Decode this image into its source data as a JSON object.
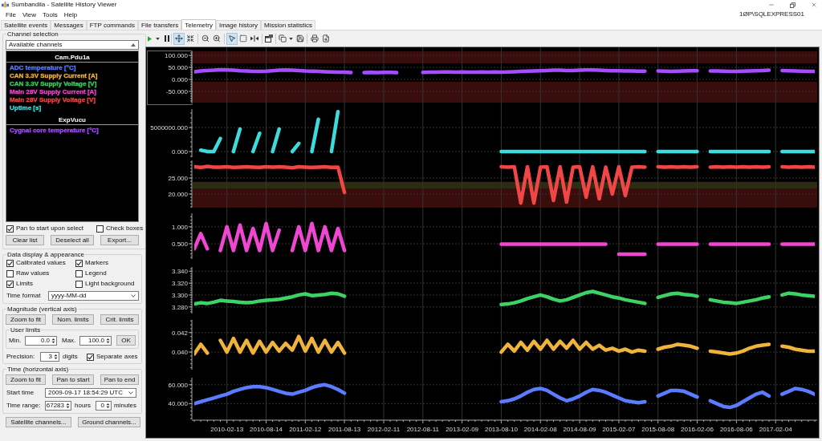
{
  "window": {
    "title": "Sumbandila - Satellite History Viewer"
  },
  "menu": [
    "File",
    "View",
    "Tools",
    "Help"
  ],
  "server": "1ØP\\SQLEXPRESS01",
  "tabs": [
    {
      "label": "Satellite events",
      "selected": false
    },
    {
      "label": "Messages",
      "selected": false
    },
    {
      "label": "FTP commands",
      "selected": false
    },
    {
      "label": "File transfers",
      "selected": false
    },
    {
      "label": "Telemetry",
      "selected": true
    },
    {
      "label": "Image history",
      "selected": false
    },
    {
      "label": "Mission statistics",
      "selected": false
    }
  ],
  "channel_selection": {
    "title": "Channel selection",
    "source": "Available channels",
    "groups": [
      {
        "name": "Cam.Pdu1a",
        "channels": [
          {
            "label": "ADC temperature [°C]",
            "color": "#5b7cff"
          },
          {
            "label": "CAN 3.3V Supply Current [A]",
            "color": "#f0b43c"
          },
          {
            "label": "CAN 3.3V Supply Voltage [V]",
            "color": "#3cd264"
          },
          {
            "label": "Main 28V Supply Current [A]",
            "color": "#f046d2"
          },
          {
            "label": "Main 28V Supply Voltage [V]",
            "color": "#f04646"
          },
          {
            "label": "Uptime [s]",
            "color": "#3cdcdc"
          }
        ]
      },
      {
        "name": "ExpVucu",
        "channels": [
          {
            "label": "Cygnal core temperature [°C]",
            "color": "#a64dff"
          }
        ]
      }
    ],
    "options": [
      {
        "label": "Pan to start upon select",
        "checked": true
      },
      {
        "label": "Check boxes",
        "checked": false
      }
    ],
    "buttons": [
      "Clear list",
      "Deselect all",
      "Export..."
    ]
  },
  "data_display": {
    "title": "Data display & appearance",
    "options": [
      {
        "label": "Calibrated values",
        "checked": true
      },
      {
        "label": "Markers",
        "checked": true
      },
      {
        "label": "Raw values",
        "checked": false
      },
      {
        "label": "Legend",
        "checked": false
      },
      {
        "label": "Limits",
        "checked": true
      },
      {
        "label": "Light background",
        "checked": false
      }
    ],
    "time_format": {
      "label": "Time format",
      "value": "yyyy-MM-dd"
    }
  },
  "magnitude": {
    "title": "Magnitude (vertical axis)",
    "buttons": [
      "Zoom to fit",
      "Nom. limits",
      "Crit. limits"
    ],
    "user_limits": {
      "title": "User limits",
      "min_label": "Min.",
      "min": "0.0",
      "max_label": "Max.",
      "max": "100.0",
      "ok": "OK"
    },
    "precision": {
      "label": "Precision:",
      "value": "3",
      "unit": "digits"
    },
    "separate_axes": {
      "label": "Separate axes",
      "checked": true
    }
  },
  "time_axis": {
    "title": "Time (horizontal axis)",
    "buttons": [
      "Zoom to fit",
      "Pan to start",
      "Pan to end"
    ],
    "start_time": {
      "label": "Start time",
      "value": "2009-09-17 18:54:29 UTC"
    },
    "time_range": {
      "label": "Time range:",
      "hours": "67283",
      "hours_unit": "hours",
      "minutes": "0",
      "minutes_unit": "minutes"
    }
  },
  "footer_buttons": [
    "Satellite channels...",
    "Ground channels..."
  ],
  "toolbar": {
    "navigation_modes": [
      {
        "selected": true
      },
      {
        "selected": false
      }
    ],
    "cursor_modes": [
      {
        "selected": true
      },
      {
        "selected": false
      },
      {
        "selected": false
      }
    ]
  },
  "plots": [
    {
      "selected": true,
      "chart_data": {
        "type": "line",
        "grid": true,
        "ylim": [
          -97,
          117
        ],
        "yticks": [
          {
            "value": 100,
            "label": "100.000"
          },
          {
            "value": 50,
            "label": "50.000"
          },
          {
            "value": 0,
            "label": "0.000"
          },
          {
            "value": -50,
            "label": "-50.000"
          }
        ],
        "bands": [
          {
            "axis": "y",
            "from": 67,
            "to": 117,
            "color": "#3a0d0d"
          },
          {
            "axis": "y",
            "from": -97,
            "to": -10,
            "color": "#3a0d0d"
          }
        ],
        "categories": [
          null,
          null,
          null,
          null,
          null,
          null,
          null,
          null,
          null,
          null,
          null,
          null,
          null,
          null,
          null,
          null,
          null,
          null,
          null,
          null,
          null,
          null,
          null,
          null,
          null,
          null,
          null,
          null,
          null,
          null,
          null,
          null,
          null,
          null,
          null,
          null,
          null,
          null,
          null,
          null,
          null,
          null,
          null,
          null,
          null,
          null,
          null,
          null,
          null,
          null,
          null,
          null,
          null,
          null,
          null,
          null,
          null,
          null,
          null,
          null,
          null,
          null,
          null,
          null,
          null,
          null,
          null,
          null,
          null,
          null,
          null,
          null,
          null,
          null,
          null,
          null,
          null,
          null,
          null,
          null,
          null,
          null,
          null,
          null,
          null,
          null,
          null,
          null,
          null,
          null,
          null,
          null,
          null,
          null,
          null,
          null
        ],
        "series": [
          {
            "color": "#a64dff",
            "values": [
              32,
              35,
              37,
              38,
              40,
              39,
              38,
              36,
              35,
              33,
              33,
              34,
              36,
              38,
              39,
              38,
              37,
              35,
              34,
              33,
              32,
              31,
              30,
              30,
              28,
              null,
              28,
              29,
              28,
              29,
              29,
              28,
              null,
              null,
              null,
              29,
              30,
              30,
              31,
              31,
              30,
              31,
              30,
              30,
              31,
              30,
              31,
              30,
              31,
              32,
              33,
              34,
              35,
              36,
              37,
              38,
              38,
              37,
              37,
              38,
              39,
              39,
              38,
              37,
              36,
              36,
              35,
              35,
              34,
              34,
              null,
              35,
              34,
              33,
              34,
              35,
              36,
              36,
              null,
              35,
              35,
              34,
              33,
              33,
              34,
              35,
              36,
              37,
              38,
              null,
              37,
              36,
              35,
              34,
              33,
              33
            ]
          }
        ]
      }
    },
    {
      "selected": false,
      "chart_data": {
        "type": "line",
        "grid": true,
        "ylim": [
          -1170000,
          8830000
        ],
        "yticks": [
          {
            "value": 5000000,
            "label": "5000000.000"
          },
          {
            "value": 0,
            "label": "0.000"
          }
        ],
        "categories": [
          null,
          null,
          null,
          null,
          null,
          null,
          null,
          null,
          null,
          null,
          null,
          null,
          null,
          null,
          null,
          null,
          null,
          null,
          null,
          null,
          null,
          null,
          null,
          null,
          null,
          null,
          null,
          null,
          null,
          null,
          null,
          null,
          null,
          null,
          null,
          null,
          null,
          null,
          null,
          null,
          null,
          null,
          null,
          null,
          null,
          null,
          null,
          null,
          null,
          null,
          null,
          null,
          null,
          null,
          null,
          null,
          null,
          null,
          null,
          null,
          null,
          null,
          null,
          null,
          null,
          null,
          null,
          null,
          null,
          null,
          null,
          null,
          null,
          null,
          null,
          null,
          null,
          null,
          null,
          null,
          null,
          null,
          null,
          null,
          null,
          null,
          null,
          null,
          null,
          null,
          null,
          null,
          null,
          null,
          null,
          null
        ],
        "series": [
          {
            "color": "#3cdcdc",
            "values": [
              null,
              300000,
              0,
              0,
              2700000,
              null,
              0,
              4700000,
              null,
              0,
              3800000,
              null,
              0,
              4700000,
              null,
              0,
              1700000,
              null,
              0,
              6700000,
              null,
              0,
              8300000,
              null,
              null,
              null,
              null,
              null,
              null,
              null,
              null,
              null,
              null,
              null,
              null,
              null,
              null,
              null,
              null,
              null,
              null,
              null,
              null,
              null,
              null,
              null,
              null,
              0,
              0,
              0,
              0,
              0,
              0,
              0,
              0,
              0,
              0,
              0,
              0,
              0,
              0,
              0,
              0,
              0,
              0,
              0,
              0,
              0,
              0,
              0,
              null,
              0,
              0,
              0,
              0,
              0,
              0,
              0,
              null,
              0,
              0,
              0,
              0,
              0,
              0,
              0,
              0,
              0,
              0,
              null,
              0,
              0,
              0,
              0,
              0,
              0
            ]
          }
        ]
      }
    },
    {
      "selected": false,
      "chart_data": {
        "type": "line",
        "grid": true,
        "ylim": [
          15.75,
          30.5
        ],
        "yticks": [
          {
            "value": 25,
            "label": "25.000"
          },
          {
            "value": 20,
            "label": "20.000"
          }
        ],
        "bands": [
          {
            "axis": "y",
            "from": 21.6,
            "to": 23.8,
            "color": "#2c2c12"
          },
          {
            "axis": "y",
            "from": 15.75,
            "to": 21.6,
            "color": "#3a0d0d"
          }
        ],
        "categories": [
          null,
          null,
          null,
          null,
          null,
          null,
          null,
          null,
          null,
          null,
          null,
          null,
          null,
          null,
          null,
          null,
          null,
          null,
          null,
          null,
          null,
          null,
          null,
          null,
          null,
          null,
          null,
          null,
          null,
          null,
          null,
          null,
          null,
          null,
          null,
          null,
          null,
          null,
          null,
          null,
          null,
          null,
          null,
          null,
          null,
          null,
          null,
          null,
          null,
          null,
          null,
          null,
          null,
          null,
          null,
          null,
          null,
          null,
          null,
          null,
          null,
          null,
          null,
          null,
          null,
          null,
          null,
          null,
          null,
          null,
          null,
          null,
          null,
          null,
          null,
          null,
          null,
          null,
          null,
          null,
          null,
          null,
          null,
          null,
          null,
          null,
          null,
          null,
          null,
          null,
          null,
          null,
          null,
          null,
          null,
          null
        ],
        "series": [
          {
            "color": "#f04646",
            "values": [
              28.5,
              28.3,
              28.6,
              28.4,
              28.4,
              28.5,
              28.3,
              28.4,
              28.5,
              28.4,
              28.3,
              28.5,
              28.4,
              28.5,
              28.4,
              28.2,
              28.5,
              28.4,
              28.3,
              28.4,
              28.5,
              28.3,
              28.4,
              20.5,
              null,
              null,
              null,
              null,
              null,
              null,
              null,
              null,
              null,
              null,
              null,
              null,
              null,
              null,
              null,
              null,
              null,
              null,
              null,
              null,
              null,
              null,
              null,
              28.5,
              28.4,
              28.5,
              17.2,
              28.5,
              17.2,
              28.4,
              28.5,
              18,
              28.5,
              17.5,
              28.4,
              28.5,
              19,
              28.5,
              18.5,
              28.4,
              20,
              28.5,
              19.5,
              28.4,
              28.5,
              28.4,
              null,
              28.5,
              28.4,
              28.5,
              28.4,
              28.5,
              28.4,
              28.5,
              null,
              28.4,
              28.5,
              28.4,
              28.5,
              28.4,
              28.5,
              28.4,
              28.5,
              28.4,
              28.5,
              null,
              28.5,
              28.4,
              28.5,
              28.4,
              28.5,
              28.4
            ]
          }
        ]
      }
    },
    {
      "selected": false,
      "chart_data": {
        "type": "line",
        "grid": true,
        "ylim": [
          0.05,
          1.4
        ],
        "yticks": [
          {
            "value": 1,
            "label": "1.000"
          },
          {
            "value": 0.5,
            "label": "0.500"
          }
        ],
        "categories": [
          null,
          null,
          null,
          null,
          null,
          null,
          null,
          null,
          null,
          null,
          null,
          null,
          null,
          null,
          null,
          null,
          null,
          null,
          null,
          null,
          null,
          null,
          null,
          null,
          null,
          null,
          null,
          null,
          null,
          null,
          null,
          null,
          null,
          null,
          null,
          null,
          null,
          null,
          null,
          null,
          null,
          null,
          null,
          null,
          null,
          null,
          null,
          null,
          null,
          null,
          null,
          null,
          null,
          null,
          null,
          null,
          null,
          null,
          null,
          null,
          null,
          null,
          null,
          null,
          null,
          null,
          null,
          null,
          null,
          null,
          null,
          null,
          null,
          null,
          null,
          null,
          null,
          null,
          null,
          null,
          null,
          null,
          null,
          null,
          null,
          null,
          null,
          null,
          null,
          null,
          null,
          null,
          null,
          null,
          null,
          null
        ],
        "series": [
          {
            "color": "#f046d2",
            "values": [
              0.35,
              0.8,
              0.35,
              null,
              0.3,
              1.0,
              0.3,
              1.05,
              0.3,
              0.95,
              0.3,
              1.1,
              0.3,
              0.9,
              null,
              0.3,
              1.0,
              0.3,
              1.1,
              0.3,
              1.0,
              0.3,
              0.95,
              0.3,
              null,
              null,
              null,
              null,
              null,
              null,
              null,
              null,
              null,
              null,
              null,
              null,
              null,
              null,
              null,
              null,
              null,
              null,
              null,
              null,
              null,
              null,
              null,
              0.49,
              0.49,
              0.49,
              0.49,
              0.49,
              0.49,
              0.49,
              0.49,
              0.49,
              0.49,
              0.49,
              0.49,
              0.49,
              0.49,
              0.49,
              0.49,
              0.49,
              null,
              0.19,
              0.19,
              0.19,
              0.19,
              0.19,
              null,
              0.49,
              0.49,
              0.49,
              0.49,
              0.49,
              0.49,
              0.49,
              null,
              0.49,
              0.49,
              0.49,
              0.49,
              0.49,
              0.49,
              0.49,
              0.49,
              0.49,
              0.49,
              null,
              0.49,
              0.49,
              0.49,
              0.49,
              0.49,
              0.49
            ]
          }
        ]
      }
    },
    {
      "selected": false,
      "chart_data": {
        "type": "line",
        "grid": true,
        "ylim": [
          3.269,
          3.347
        ],
        "yticks": [
          {
            "value": 3.34,
            "label": "3.340"
          },
          {
            "value": 3.32,
            "label": "3.320"
          },
          {
            "value": 3.3,
            "label": "3.300"
          },
          {
            "value": 3.28,
            "label": "3.280"
          }
        ],
        "categories": [
          null,
          null,
          null,
          null,
          null,
          null,
          null,
          null,
          null,
          null,
          null,
          null,
          null,
          null,
          null,
          null,
          null,
          null,
          null,
          null,
          null,
          null,
          null,
          null,
          null,
          null,
          null,
          null,
          null,
          null,
          null,
          null,
          null,
          null,
          null,
          null,
          null,
          null,
          null,
          null,
          null,
          null,
          null,
          null,
          null,
          null,
          null,
          null,
          null,
          null,
          null,
          null,
          null,
          null,
          null,
          null,
          null,
          null,
          null,
          null,
          null,
          null,
          null,
          null,
          null,
          null,
          null,
          null,
          null,
          null,
          null,
          null,
          null,
          null,
          null,
          null,
          null,
          null,
          null,
          null,
          null,
          null,
          null,
          null,
          null,
          null,
          null,
          null,
          null,
          null,
          null,
          null,
          null,
          null,
          null,
          null
        ],
        "series": [
          {
            "color": "#3cd264",
            "values": [
              3.285,
              3.287,
              3.286,
              3.288,
              3.291,
              3.29,
              3.289,
              3.288,
              3.287,
              3.288,
              3.29,
              3.291,
              3.292,
              3.293,
              3.295,
              3.297,
              3.3,
              3.302,
              3.299,
              3.3,
              3.301,
              3.303,
              3.302,
              3.298,
              null,
              null,
              null,
              null,
              null,
              null,
              null,
              null,
              null,
              null,
              null,
              null,
              null,
              null,
              null,
              null,
              null,
              null,
              null,
              null,
              null,
              null,
              null,
              3.284,
              3.285,
              3.287,
              3.29,
              3.294,
              3.297,
              3.3,
              3.297,
              3.293,
              3.29,
              3.292,
              3.296,
              3.3,
              3.304,
              3.306,
              3.303,
              3.3,
              3.297,
              3.295,
              3.292,
              3.29,
              3.288,
              3.286,
              null,
              3.296,
              3.299,
              3.302,
              3.303,
              3.301,
              3.3,
              3.298,
              null,
              3.292,
              3.29,
              3.288,
              3.287,
              3.286,
              3.288,
              3.29,
              3.292,
              3.295,
              3.297,
              null,
              3.3,
              3.303,
              3.302,
              3.3,
              3.299,
              3.298
            ]
          }
        ]
      }
    },
    {
      "selected": false,
      "chart_data": {
        "type": "line",
        "grid": true,
        "ylim": [
          0.0382,
          0.0433
        ],
        "yticks": [
          {
            "value": 0.042,
            "label": "0.042"
          },
          {
            "value": 0.04,
            "label": "0.040"
          }
        ],
        "categories": [
          null,
          null,
          null,
          null,
          null,
          null,
          null,
          null,
          null,
          null,
          null,
          null,
          null,
          null,
          null,
          null,
          null,
          null,
          null,
          null,
          null,
          null,
          null,
          null,
          null,
          null,
          null,
          null,
          null,
          null,
          null,
          null,
          null,
          null,
          null,
          null,
          null,
          null,
          null,
          null,
          null,
          null,
          null,
          null,
          null,
          null,
          null,
          null,
          null,
          null,
          null,
          null,
          null,
          null,
          null,
          null,
          null,
          null,
          null,
          null,
          null,
          null,
          null,
          null,
          null,
          null,
          null,
          null,
          null,
          null,
          null,
          null,
          null,
          null,
          null,
          null,
          null,
          null,
          null,
          null,
          null,
          null,
          null,
          null,
          null,
          null,
          null,
          null,
          null,
          null,
          null,
          null,
          null,
          null,
          null,
          null
        ],
        "series": [
          {
            "color": "#f0b43c",
            "values": [
              0.0398,
              0.0408,
              0.0399,
              null,
              0.0412,
              0.04,
              0.0414,
              0.04,
              0.0412,
              0.0399,
              0.0411,
              0.04,
              0.041,
              0.0401,
              0.0409,
              0.0402,
              0.0416,
              0.0401,
              0.0414,
              0.04,
              0.0412,
              0.04,
              0.041,
              0.0399,
              null,
              null,
              null,
              null,
              null,
              null,
              null,
              null,
              null,
              null,
              null,
              null,
              null,
              null,
              null,
              null,
              null,
              null,
              null,
              null,
              null,
              null,
              null,
              0.04,
              0.0408,
              0.0401,
              0.041,
              0.0402,
              0.0411,
              0.0403,
              0.0412,
              0.0403,
              0.0411,
              0.0404,
              0.0412,
              0.0403,
              0.041,
              0.0403,
              0.0407,
              0.0402,
              0.0404,
              0.0401,
              0.0403,
              0.04,
              0.0402,
              0.0401,
              null,
              0.0403,
              0.0405,
              0.0406,
              0.0408,
              0.0407,
              0.0406,
              0.0404,
              null,
              0.0401,
              0.04,
              0.0399,
              0.0398,
              0.0399,
              0.0401,
              0.0404,
              0.0406,
              0.0407,
              0.0408,
              null,
              0.0406,
              0.0405,
              0.0403,
              0.0402,
              0.0401,
              0.0401
            ]
          }
        ]
      }
    },
    {
      "selected": false,
      "chart_data": {
        "type": "line",
        "grid": true,
        "ylim": [
          23.3,
          67.5
        ],
        "yticks": [
          {
            "value": 60,
            "label": "60.000"
          },
          {
            "value": 40,
            "label": "40.000"
          }
        ],
        "categories": [
          null,
          null,
          null,
          null,
          null,
          "2010-02-13",
          null,
          null,
          null,
          null,
          null,
          "2010-08-14",
          null,
          null,
          null,
          null,
          null,
          "2011-02-12",
          null,
          null,
          null,
          null,
          null,
          "2011-08-13",
          null,
          null,
          null,
          null,
          null,
          "2012-02-11",
          null,
          null,
          null,
          null,
          null,
          "2012-08-11",
          null,
          null,
          null,
          null,
          null,
          "2013-02-09",
          null,
          null,
          null,
          null,
          null,
          "2013-08-10",
          null,
          null,
          null,
          null,
          null,
          "2014-02-08",
          null,
          null,
          null,
          null,
          null,
          "2014-08-09",
          null,
          null,
          null,
          null,
          null,
          "2015-02-07",
          null,
          null,
          null,
          null,
          null,
          "2015-08-08",
          null,
          null,
          null,
          null,
          null,
          "2016-02-06",
          null,
          null,
          null,
          null,
          null,
          "2016-08-06",
          null,
          null,
          null,
          null,
          null,
          "2017-02-04",
          null,
          null,
          null,
          null,
          null,
          null
        ],
        "series": [
          {
            "color": "#5b7cff",
            "values": [
              40,
              42,
              44,
              46,
              48,
              50,
              53,
              55,
              57,
              58,
              58,
              57,
              55,
              53,
              51,
              50,
              52,
              54,
              57,
              59,
              60,
              58,
              55,
              51,
              null,
              null,
              null,
              null,
              null,
              null,
              null,
              null,
              null,
              null,
              null,
              null,
              null,
              null,
              null,
              null,
              null,
              null,
              null,
              null,
              null,
              null,
              null,
              42,
              43,
              45,
              48,
              52,
              55,
              56,
              54,
              50,
              46,
              43,
              45,
              48,
              52,
              55,
              54,
              52,
              49,
              46,
              43,
              42,
              41,
              42,
              null,
              48,
              51,
              54,
              54,
              53,
              50,
              47,
              null,
              43,
              40,
              37,
              36,
              38,
              42,
              46,
              50,
              52,
              48,
              null,
              50,
              53,
              56,
              55,
              53,
              50
            ]
          }
        ]
      }
    }
  ]
}
